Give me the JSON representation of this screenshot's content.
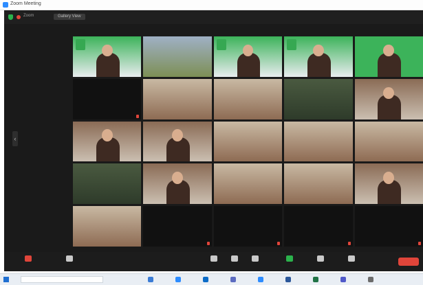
{
  "window": {
    "title": "Zoom Meeting"
  },
  "top_bar": {
    "label": "Zoom",
    "view_label": "Gallery View"
  },
  "side_nav": {
    "left_arrow": "‹"
  },
  "colors": {
    "zoom_blue": "#2d8cff",
    "toolbar_bg": "#1c1c1c",
    "grid_bg": "#1a1a1a",
    "mute_red": "#e0453a",
    "share_green": "#2bb24c",
    "logo_green": "#3cb35a"
  },
  "participants": [
    {
      "name": "",
      "camera": true,
      "style": "logo"
    },
    {
      "name": "",
      "camera": true,
      "style": "field"
    },
    {
      "name": "",
      "camera": true,
      "style": "logo"
    },
    {
      "name": "",
      "camera": true,
      "style": "logo"
    },
    {
      "name": "",
      "camera": true,
      "style": "green"
    },
    {
      "name": "",
      "camera": false,
      "style": "off"
    },
    {
      "name": "",
      "camera": true,
      "style": "class"
    },
    {
      "name": "",
      "camera": true,
      "style": "class"
    },
    {
      "name": "",
      "camera": true,
      "style": "dark"
    },
    {
      "name": "",
      "camera": true,
      "style": "person"
    },
    {
      "name": "",
      "camera": true,
      "style": "person"
    },
    {
      "name": "",
      "camera": true,
      "style": "person"
    },
    {
      "name": "",
      "camera": true,
      "style": "class"
    },
    {
      "name": "",
      "camera": true,
      "style": "class"
    },
    {
      "name": "",
      "camera": true,
      "style": "class"
    },
    {
      "name": "",
      "camera": true,
      "style": "dark"
    },
    {
      "name": "",
      "camera": true,
      "style": "person"
    },
    {
      "name": "",
      "camera": true,
      "style": "class"
    },
    {
      "name": "",
      "camera": true,
      "style": "class"
    },
    {
      "name": "",
      "camera": true,
      "style": "person"
    },
    {
      "name": "",
      "camera": true,
      "style": "class"
    },
    {
      "name": "",
      "camera": false,
      "style": "off"
    },
    {
      "name": "",
      "camera": false,
      "style": "off"
    },
    {
      "name": "",
      "camera": false,
      "style": "off"
    },
    {
      "name": "",
      "camera": false,
      "style": "off"
    }
  ],
  "toolbar": {
    "buttons": [
      {
        "icon": "microphone-muted-icon",
        "label": "",
        "color": "red"
      },
      {
        "icon": "video-icon",
        "label": ""
      },
      {
        "icon": "security-icon",
        "label": ""
      },
      {
        "icon": "participants-icon",
        "label": ""
      },
      {
        "icon": "chat-icon",
        "label": ""
      },
      {
        "icon": "share-screen-icon",
        "label": "",
        "color": "green"
      },
      {
        "icon": "record-icon",
        "label": ""
      },
      {
        "icon": "reactions-icon",
        "label": ""
      }
    ],
    "end_label": ""
  },
  "taskbar": {
    "search_placeholder": "",
    "icons": [
      "folder-icon",
      "browser-icon",
      "mail-icon",
      "store-icon",
      "zoom-icon",
      "word-icon",
      "excel-icon",
      "teams-icon",
      "settings-icon"
    ]
  }
}
